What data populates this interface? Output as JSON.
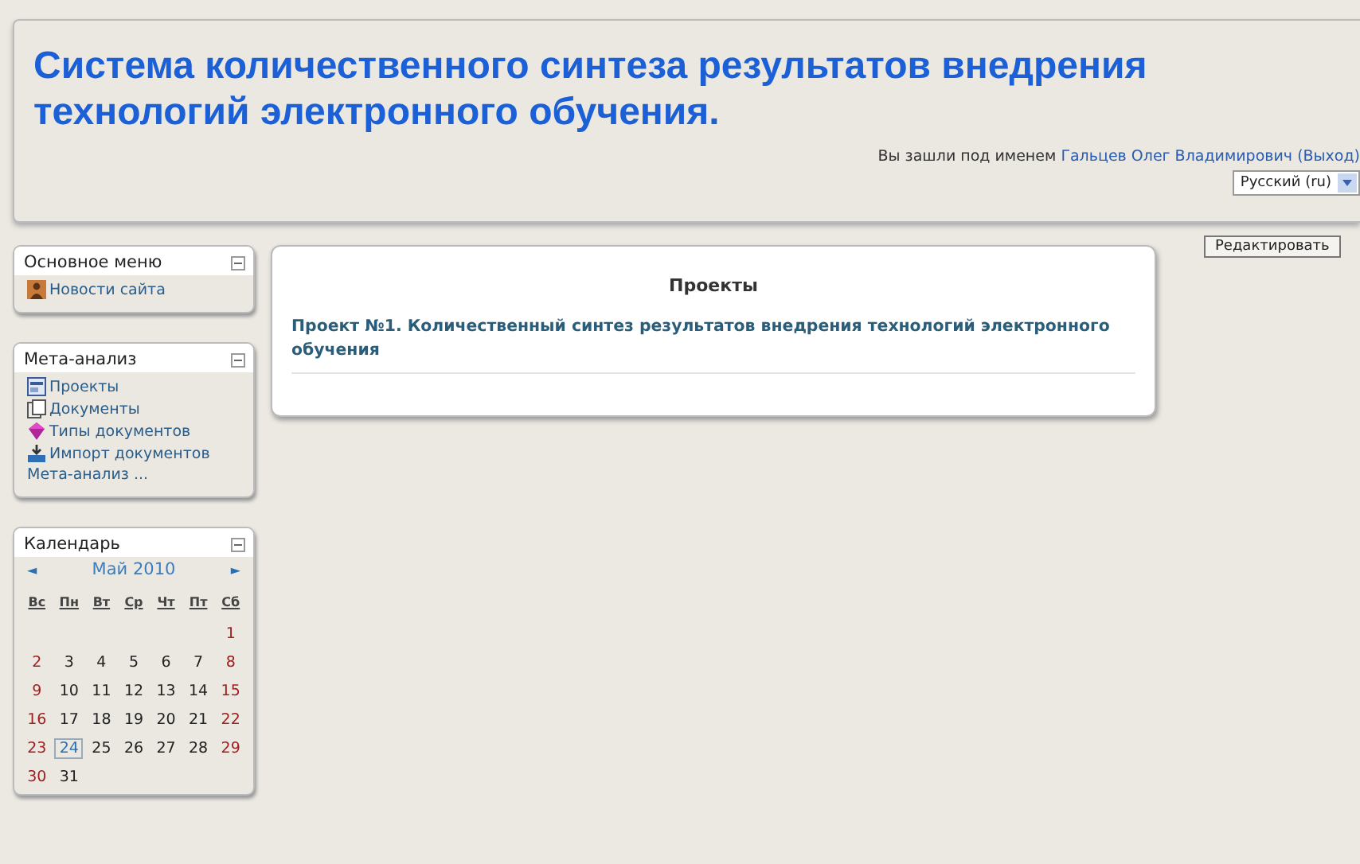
{
  "header": {
    "title": "Система количественного синтеза результатов внедрения технологий электронного обучения.",
    "login": {
      "prefix": "Вы зашли под именем",
      "user": "Гальцев Олег Владимирович",
      "logout": "(Выход)"
    },
    "language": "Русский (ru)"
  },
  "blocks": [
    {
      "title": "Основное меню",
      "items": [
        {
          "label": "Новости сайта",
          "kind": "news"
        }
      ]
    },
    {
      "title": "Мета-анализ",
      "items": [
        {
          "label": "Проекты",
          "kind": "projects"
        },
        {
          "label": "Документы",
          "kind": "documents"
        },
        {
          "label": "Типы документов",
          "kind": "types"
        },
        {
          "label": "Импорт документов",
          "kind": "import"
        },
        {
          "label": "Мета-анализ ...",
          "kind": "more"
        }
      ]
    }
  ],
  "calendar": {
    "title": "Календарь",
    "prev": "◄",
    "month": "Май 2010",
    "next": "►",
    "weekdays": [
      "Вс",
      "Пн",
      "Вт",
      "Ср",
      "Чт",
      "Пт",
      "Сб"
    ],
    "weeks": [
      [
        {
          "day": "1",
          "today": false
        }
      ],
      [
        {
          "day": "2",
          "today": false
        },
        {
          "day": "3",
          "today": false
        },
        {
          "day": "4",
          "today": false
        },
        {
          "day": "5",
          "today": false
        },
        {
          "day": "6",
          "today": false
        },
        {
          "day": "7",
          "today": false
        },
        {
          "day": "8",
          "today": false
        }
      ],
      [
        {
          "day": "9",
          "today": false
        },
        {
          "day": "10",
          "today": false
        },
        {
          "day": "11",
          "today": false
        },
        {
          "day": "12",
          "today": false
        },
        {
          "day": "13",
          "today": false
        },
        {
          "day": "14",
          "today": false
        },
        {
          "day": "15",
          "today": false
        }
      ],
      [
        {
          "day": "16",
          "today": false
        },
        {
          "day": "17",
          "today": false
        },
        {
          "day": "18",
          "today": false
        },
        {
          "day": "19",
          "today": false
        },
        {
          "day": "20",
          "today": false
        },
        {
          "day": "21",
          "today": false
        },
        {
          "day": "22",
          "today": false
        }
      ],
      [
        {
          "day": "23",
          "today": false
        },
        {
          "day": "24",
          "today": true
        },
        {
          "day": "25",
          "today": false
        },
        {
          "day": "26",
          "today": false
        },
        {
          "day": "27",
          "today": false
        },
        {
          "day": "28",
          "today": false
        },
        {
          "day": "29",
          "today": false
        }
      ],
      [
        {
          "day": "30",
          "today": false
        },
        {
          "day": "31",
          "today": false
        }
      ]
    ]
  },
  "main": {
    "title": "Проекты",
    "projects": [
      "Проект №1. Количественный синтез результатов внедрения технологий электронного обучения"
    ]
  },
  "edit_button": "Редактировать"
}
